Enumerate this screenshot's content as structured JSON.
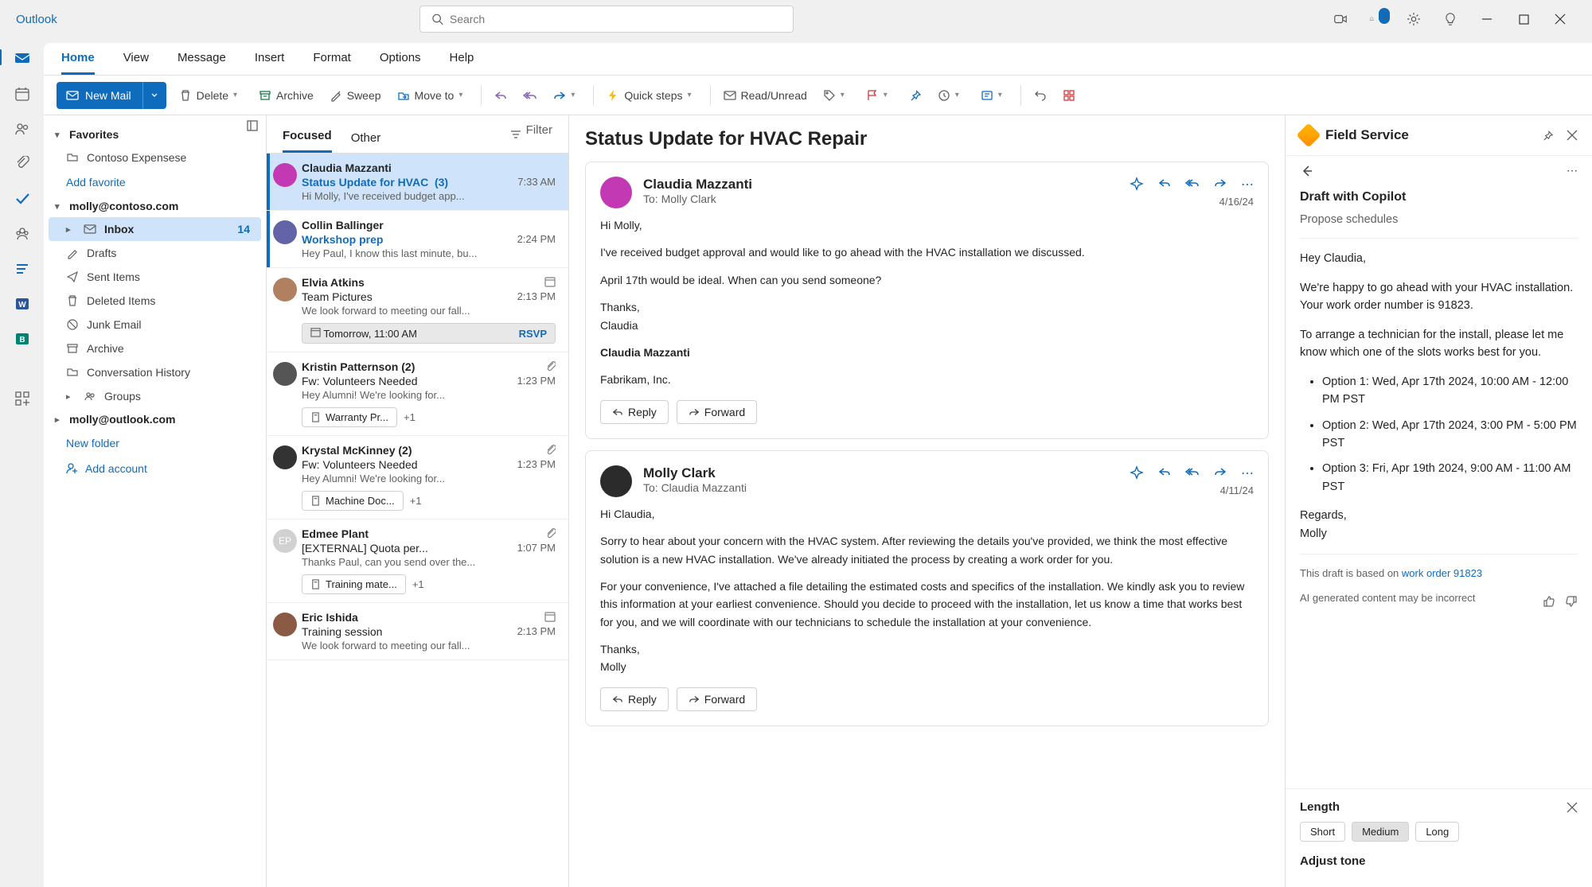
{
  "app": {
    "brand": "Outlook"
  },
  "search": {
    "placeholder": "Search"
  },
  "sys": {
    "notif_count": "1"
  },
  "tabs": [
    "Home",
    "View",
    "Message",
    "Insert",
    "Format",
    "Options",
    "Help"
  ],
  "active_tab": 0,
  "ribbon": {
    "new_mail": "New Mail",
    "delete": "Delete",
    "archive": "Archive",
    "sweep": "Sweep",
    "move_to": "Move to",
    "quick_steps": "Quick steps",
    "read_unread": "Read/Unread"
  },
  "folders": {
    "favorites": "Favorites",
    "fav_items": [
      "Contoso Expensese"
    ],
    "add_fav": "Add favorite",
    "accounts": [
      {
        "name": "molly@contoso.com",
        "folders": [
          {
            "label": "Inbox",
            "count": "14",
            "sel": true
          },
          {
            "label": "Drafts"
          },
          {
            "label": "Sent Items"
          },
          {
            "label": "Deleted Items"
          },
          {
            "label": "Junk Email"
          },
          {
            "label": "Archive"
          },
          {
            "label": "Conversation History"
          },
          {
            "label": "Groups",
            "chev": true
          }
        ]
      },
      {
        "name": "molly@outlook.com",
        "collapsed": true
      }
    ],
    "new_folder": "New folder",
    "add_account": "Add account"
  },
  "msglist": {
    "focused": "Focused",
    "other": "Other",
    "filter": "Filter",
    "items": [
      {
        "from": "Claudia Mazzanti",
        "subj": "Status Update for HVAC",
        "count": "(3)",
        "time": "7:33 AM",
        "preview": "Hi Molly, I've received budget app...",
        "sel": true,
        "unread": true,
        "subj_blue": true,
        "av": "#c239b3",
        "chev": true
      },
      {
        "from": "Collin Ballinger",
        "subj": "Workshop prep",
        "time": "2:24 PM",
        "preview": "Hey Paul, I know this last minute, bu...",
        "unread": true,
        "subj_blue": true,
        "av": "#6264a7",
        "chev": true
      },
      {
        "from": "Elvia Atkins",
        "subj": "Team Pictures",
        "time": "2:13 PM",
        "preview": "We look forward to meeting our fall...",
        "av": "#b08060",
        "cal": true,
        "rsvp": "Tomorrow, 11:00 AM",
        "rsvp_btn": "RSVP"
      },
      {
        "from": "Kristin Patternson (2)",
        "subj": "Fw: Volunteers Needed",
        "time": "1:23 PM",
        "preview": "Hey Alumni! We're looking for...",
        "av": "#555",
        "att": true,
        "chip": "Warranty Pr...",
        "plus": "+1"
      },
      {
        "from": "Krystal McKinney (2)",
        "subj": "Fw: Volunteers Needed",
        "time": "1:23 PM",
        "preview": "Hey Alumni! We're looking for...",
        "av": "#333",
        "att": true,
        "chip": "Machine Doc...",
        "plus": "+1"
      },
      {
        "from": "Edmee Plant",
        "subj": "[EXTERNAL] Quota per...",
        "time": "1:07 PM",
        "preview": "Thanks Paul, can you send over the...",
        "av": "#d1d1d1",
        "avtxt": "EP",
        "att": true,
        "chip": "Training mate...",
        "plus": "+1"
      },
      {
        "from": "Eric Ishida",
        "subj": "Training session",
        "time": "2:13 PM",
        "preview": "We look forward to meeting our fall...",
        "av": "#8a5a44",
        "cal": true
      }
    ]
  },
  "reading": {
    "subject": "Status Update for HVAC Repair",
    "emails": [
      {
        "from": "Claudia Mazzanti",
        "to": "To: Molly Clark",
        "date": "4/16/24",
        "body": [
          "Hi Molly,",
          "I've received budget approval and would like to go ahead with the HVAC installation we discussed.",
          "April 17th would be ideal. When can you send someone?",
          "Thanks,\nClaudia"
        ],
        "sig_name": "Claudia Mazzanti",
        "sig_co": "Fabrikam, Inc.",
        "av": "#c239b3",
        "reply": "Reply",
        "forward": "Forward"
      },
      {
        "from": "Molly Clark",
        "to": "To: Claudia Mazzanti",
        "date": "4/11/24",
        "body": [
          "Hi Claudia,",
          "Sorry to hear about your concern with the HVAC system. After reviewing the details you've provided, we think the most effective solution is a new HVAC installation. We've already initiated the process by creating a work order for you.",
          "For your convenience, I've attached a file detailing the estimated costs and specifics of the installation. We kindly ask you to review this information at your earliest convenience. Should you decide to proceed with the installation, let us know a time that works best for you, and we will coordinate with our technicians to schedule the installation at your convenience.",
          "Thanks,\nMolly"
        ],
        "av": "#2b2b2b",
        "reply": "Reply",
        "forward": "Forward"
      }
    ]
  },
  "side": {
    "title": "Field Service",
    "draft_title": "Draft with Copilot",
    "draft_sub": "Propose schedules",
    "greet": "Hey Claudia,",
    "p1": "We're happy to go ahead with your HVAC installation. Your work order number is 91823.",
    "p2": "To arrange a technician for the install, please let me know which one of the slots works best for you.",
    "options": [
      "Option 1: Wed, Apr 17th 2024, 10:00 AM - 12:00 PM PST",
      "Option 2: Wed, Apr 17th 2024, 3:00 PM - 5:00 PM PST",
      "Option 3: Fri, Apr 19th 2024, 9:00 AM - 11:00 AM PST"
    ],
    "signoff": "Regards,\nMolly",
    "note_pre": "This draft is based on ",
    "note_link": "work order 91823",
    "disclaimer": "AI generated content may be incorrect",
    "length_label": "Length",
    "length": [
      "Short",
      "Medium",
      "Long"
    ],
    "length_sel": 1,
    "tone_label": "Adjust tone"
  }
}
